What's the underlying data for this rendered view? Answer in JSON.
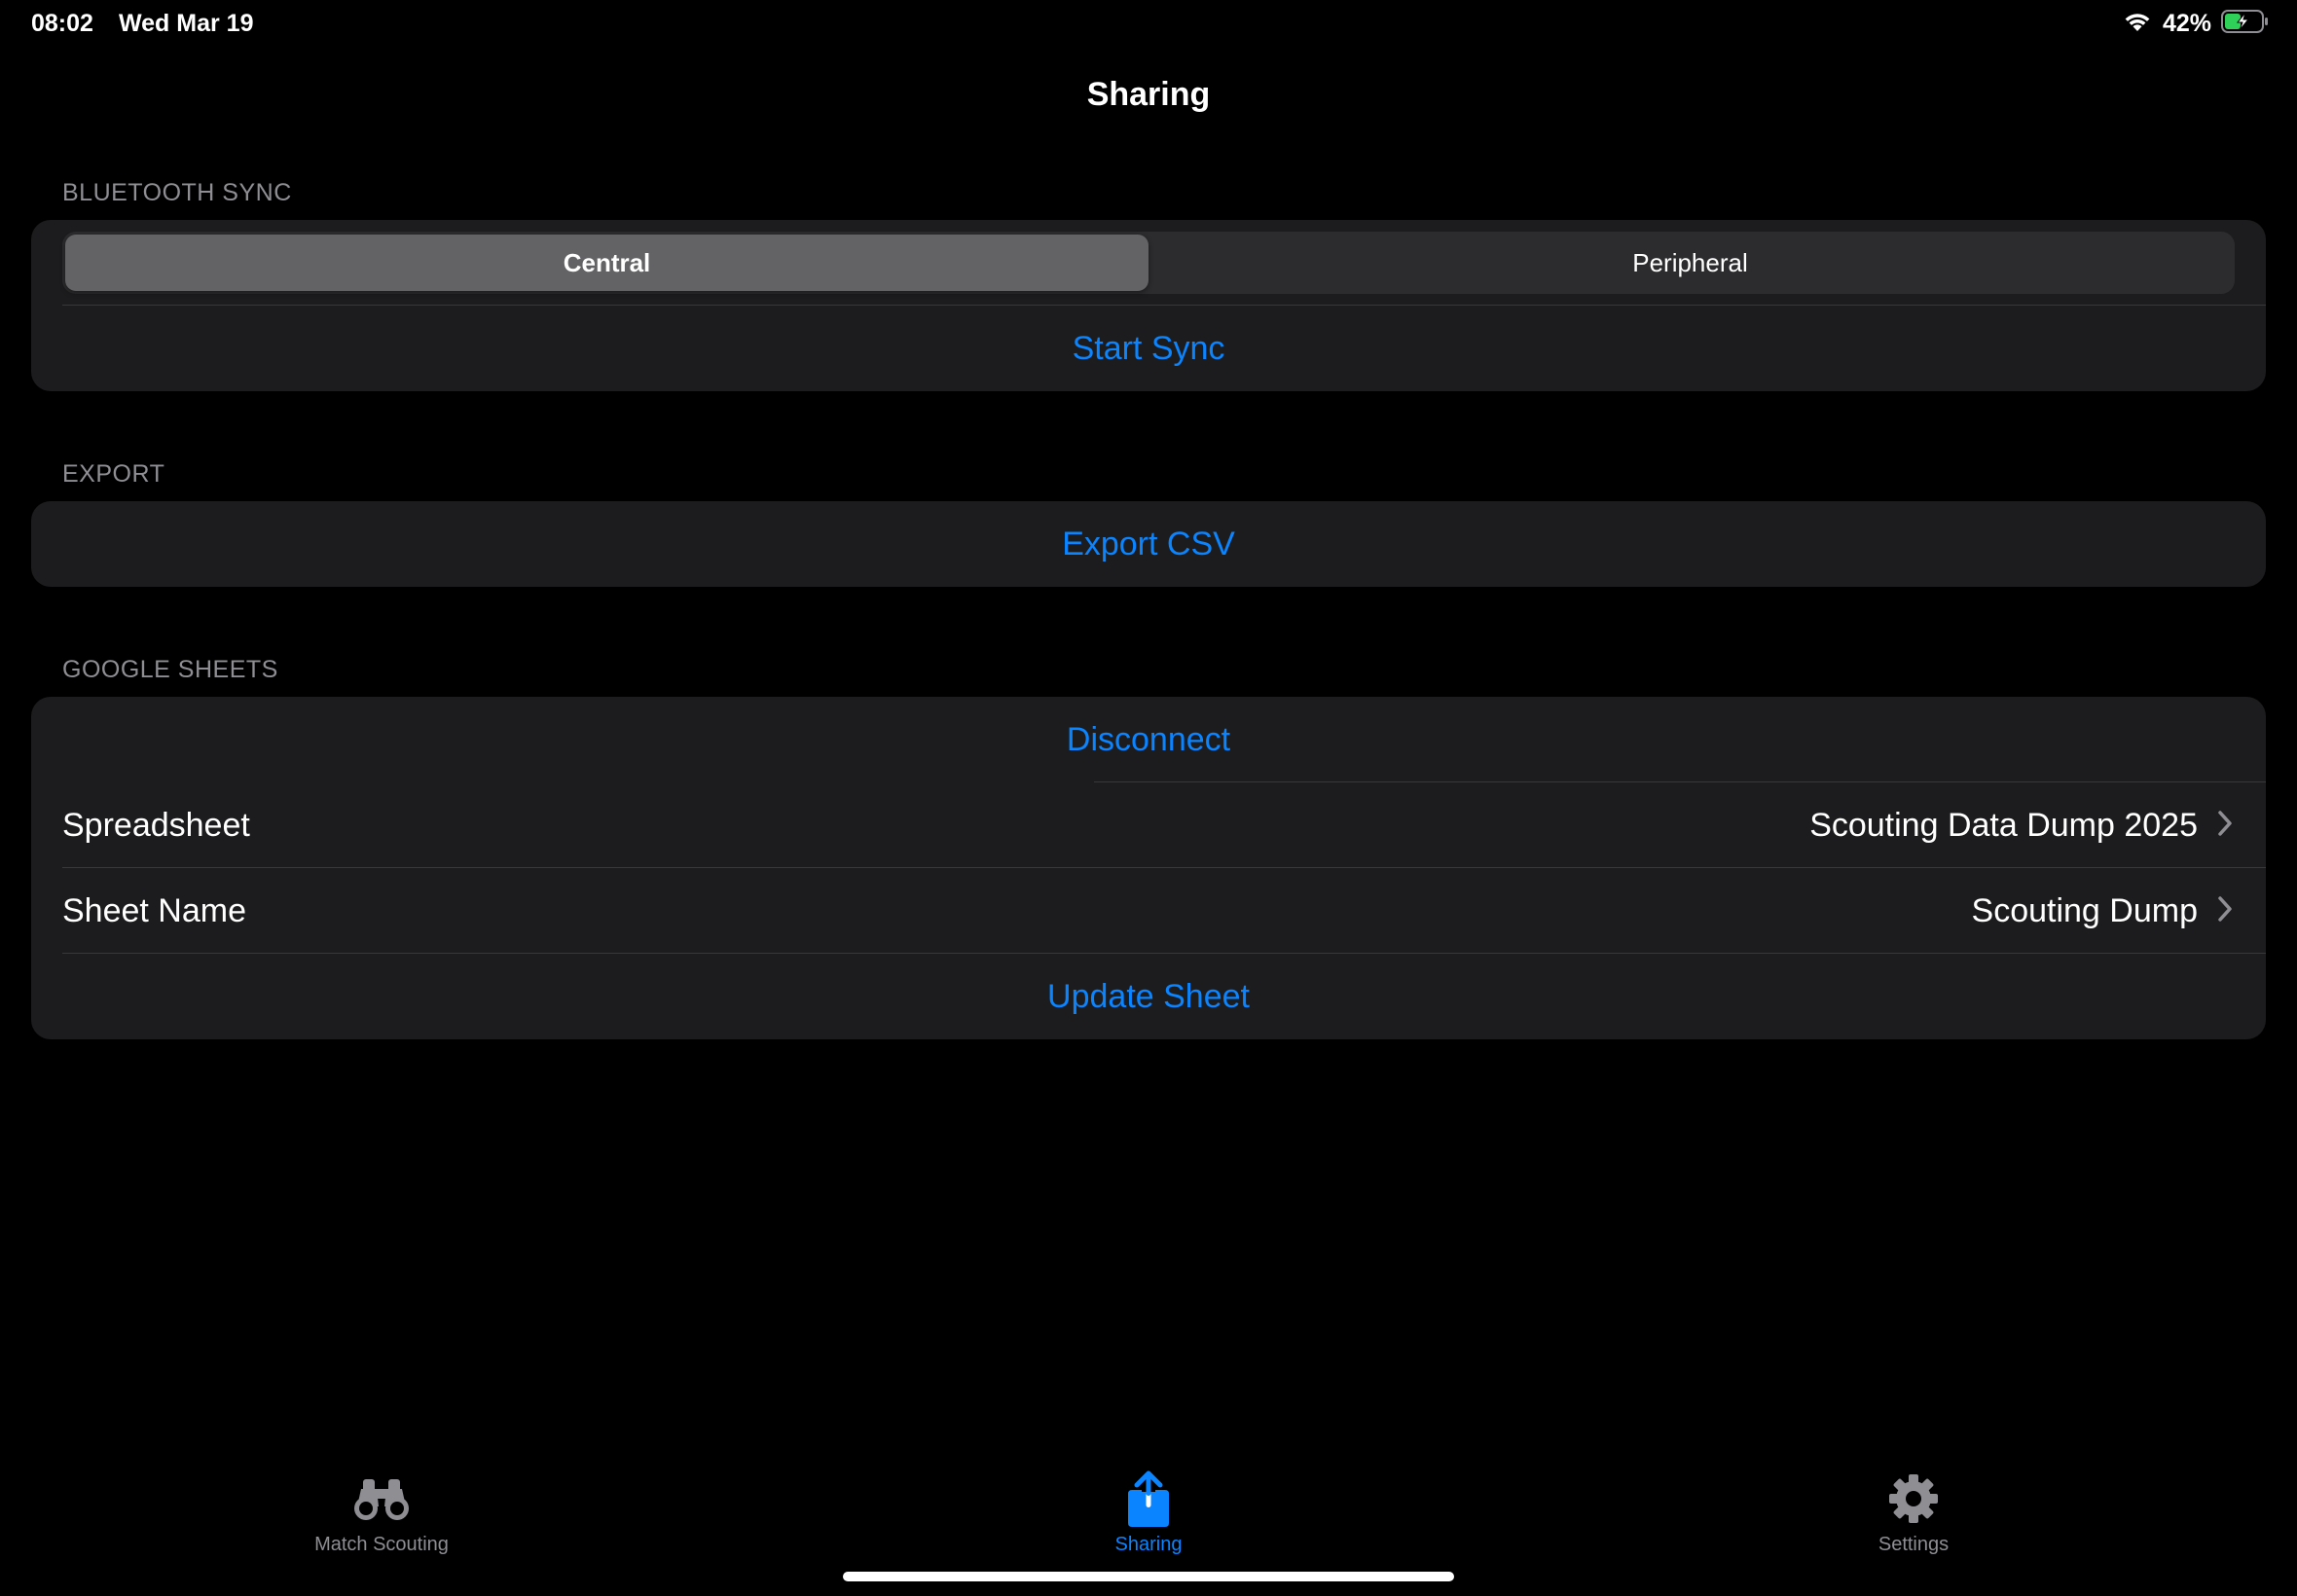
{
  "status_bar": {
    "time": "08:02",
    "date": "Wed Mar 19",
    "battery": "42%"
  },
  "nav": {
    "title": "Sharing"
  },
  "bluetooth": {
    "header": "BLUETOOTH SYNC",
    "segments": [
      "Central",
      "Peripheral"
    ],
    "selected": "Central",
    "start_sync": "Start Sync"
  },
  "export": {
    "header": "EXPORT",
    "export_csv": "Export CSV"
  },
  "google_sheets": {
    "header": "GOOGLE SHEETS",
    "disconnect": "Disconnect",
    "spreadsheet_label": "Spreadsheet",
    "spreadsheet_value": "Scouting Data Dump 2025",
    "sheet_name_label": "Sheet Name",
    "sheet_name_value": "Scouting Dump",
    "update_sheet": "Update Sheet"
  },
  "tab_bar": {
    "items": [
      {
        "label": "Match Scouting",
        "icon": "binoculars-icon"
      },
      {
        "label": "Sharing",
        "icon": "share-icon"
      },
      {
        "label": "Settings",
        "icon": "gear-icon"
      }
    ],
    "active": "Sharing"
  },
  "colors": {
    "accent": "#0a84ff",
    "background": "#000000",
    "group": "#1c1c1e",
    "secondary_text": "#8e8e93",
    "battery_fill": "#30d158"
  }
}
